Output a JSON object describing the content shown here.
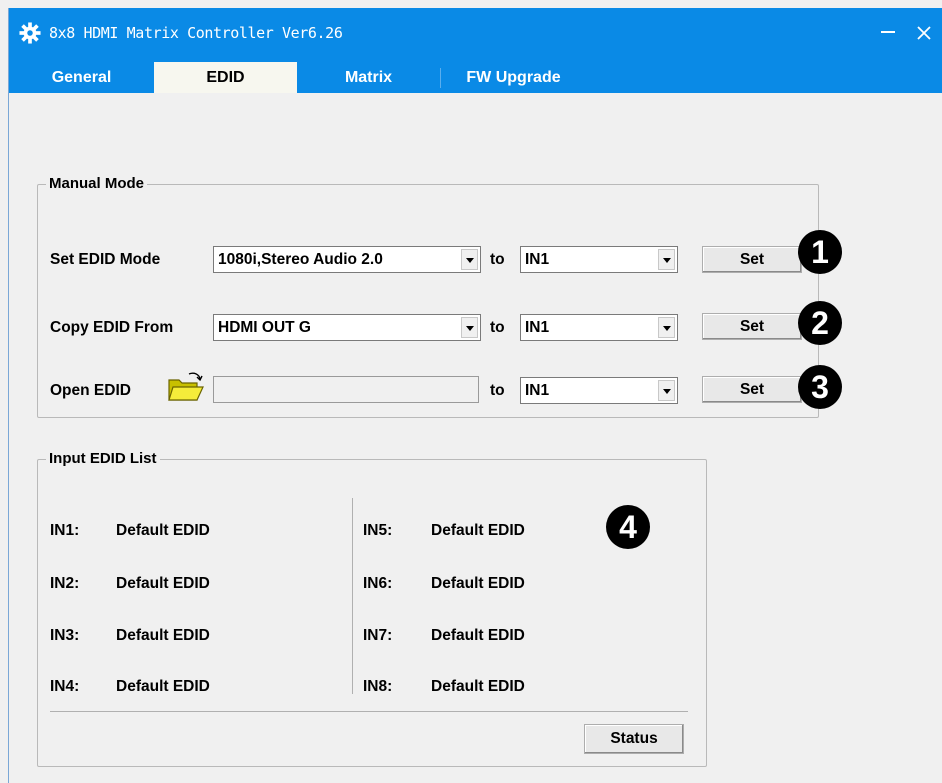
{
  "window": {
    "title": "8x8 HDMI Matrix Controller Ver6.26",
    "icon": "gear-icon"
  },
  "tabs": [
    {
      "label": "General"
    },
    {
      "label": "EDID",
      "active": true
    },
    {
      "label": "Matrix"
    },
    {
      "label": "FW Upgrade"
    }
  ],
  "manual_mode": {
    "legend": "Manual Mode",
    "set_edid": {
      "label": "Set EDID Mode",
      "value": "1080i,Stereo Audio 2.0",
      "to": "to",
      "target": "IN1",
      "button": "Set",
      "badge": "1"
    },
    "copy_edid": {
      "label": "Copy EDID From",
      "value": "HDMI OUT G",
      "to": "to",
      "target": "IN1",
      "button": "Set",
      "badge": "2"
    },
    "open_edid": {
      "label": "Open EDID",
      "value": "",
      "to": "to",
      "target": "IN1",
      "button": "Set",
      "badge": "3",
      "icon": "folder-open-icon"
    }
  },
  "input_list": {
    "legend": "Input EDID List",
    "badge": "4",
    "left": [
      {
        "port": "IN1:",
        "value": "Default EDID"
      },
      {
        "port": "IN2:",
        "value": "Default EDID"
      },
      {
        "port": "IN3:",
        "value": "Default EDID"
      },
      {
        "port": "IN4:",
        "value": "Default EDID"
      }
    ],
    "right": [
      {
        "port": "IN5:",
        "value": "Default EDID"
      },
      {
        "port": "IN6:",
        "value": "Default EDID"
      },
      {
        "port": "IN7:",
        "value": "Default EDID"
      },
      {
        "port": "IN8:",
        "value": "Default EDID"
      }
    ],
    "status_button": "Status"
  },
  "colors": {
    "accent": "#0a8ae6",
    "active_tab": "#f7f7ef",
    "window_bg": "#f0f0f0"
  }
}
